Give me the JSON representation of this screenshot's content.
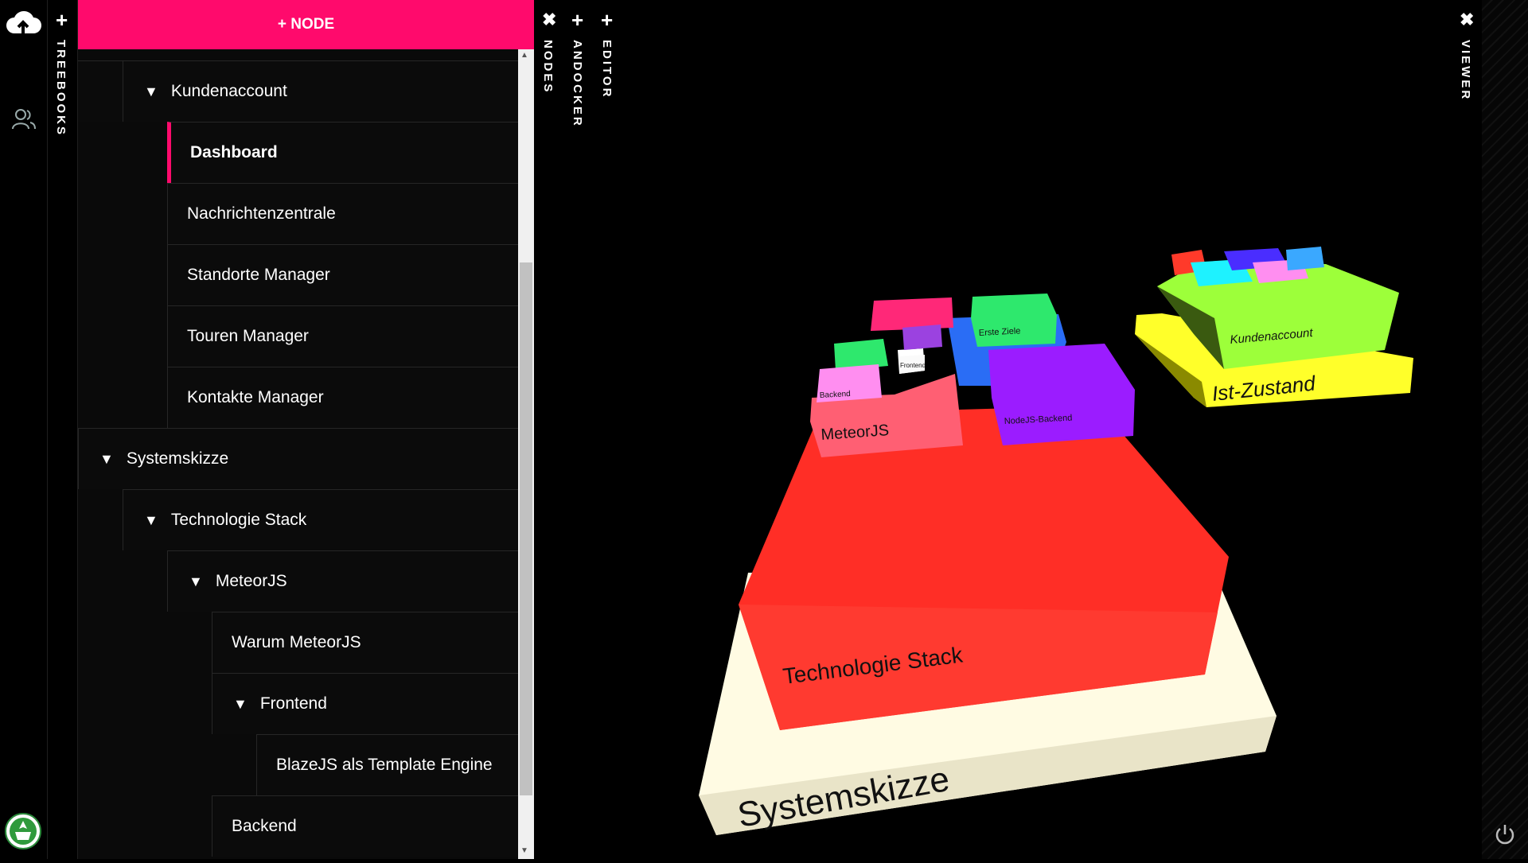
{
  "sidebar": {
    "logo_icon": "cloud-upload-icon",
    "users_icon": "users-icon",
    "avatar_icon": "emblem-avatar-icon"
  },
  "treebooks": {
    "add": "+",
    "label": "TREEBOOKS"
  },
  "tree": {
    "add_node_label": "+ NODE",
    "items": [
      {
        "label": "Kundenaccount",
        "expandable": true
      },
      {
        "label": "Dashboard",
        "selected": true
      },
      {
        "label": "Nachrichtenzentrale"
      },
      {
        "label": "Standorte Manager"
      },
      {
        "label": "Touren Manager"
      },
      {
        "label": "Kontakte Manager"
      },
      {
        "label": "Systemskizze",
        "expandable": true
      },
      {
        "label": "Technologie Stack",
        "expandable": true
      },
      {
        "label": "MeteorJS",
        "expandable": true
      },
      {
        "label": "Warum MeteorJS"
      },
      {
        "label": "Frontend",
        "expandable": true
      },
      {
        "label": "BlazeJS als Template Engine"
      },
      {
        "label": "Backend"
      }
    ],
    "expand_glyph": "▼"
  },
  "panels": {
    "nodes": {
      "action": "✖",
      "label": "NODES"
    },
    "andocker": {
      "action": "+",
      "label": "ANDOCKER"
    },
    "editor": {
      "action": "+",
      "label": "EDITOR"
    },
    "viewer": {
      "action": "✖",
      "label": "VIEWER"
    }
  },
  "scene": {
    "blocks": {
      "systemskizze": "Systemskizze",
      "technologie_stack": "Technologie Stack",
      "meteorjs": "MeteorJS",
      "backend": "Backend",
      "frontend": "Frontend",
      "erste_ziele": "Erste Ziele",
      "nodejs_backend": "NodeJS-Backend",
      "kundenaccount": "Kundenaccount",
      "ist_zustand": "Ist-Zustand"
    },
    "colors": {
      "red": "#ff2e26",
      "cream": "#fffbe3",
      "pink": "#ff5f73",
      "purple": "#9b1cff",
      "green": "#2ee86d",
      "lime": "#9dff3a",
      "yellow": "#ffff2a",
      "accent": "#ff0a6c"
    }
  },
  "footer": {
    "power_icon": "power-icon"
  }
}
